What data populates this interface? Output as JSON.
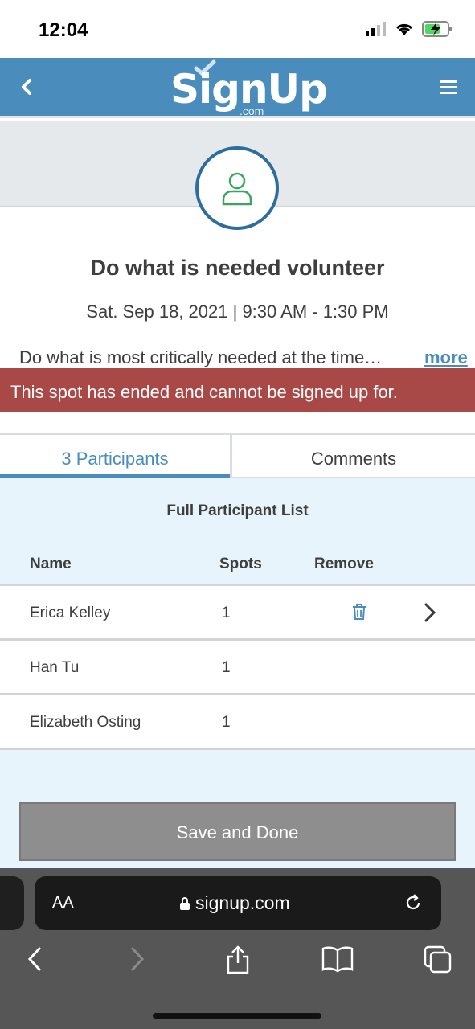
{
  "status_bar": {
    "time": "12:04"
  },
  "header": {
    "logo_text": "SignUp",
    "logo_suffix": ".com"
  },
  "event": {
    "title": "Do what is needed volunteer",
    "datetime": "Sat. Sep 18, 2021 | 9:30 AM - 1:30 PM",
    "description": "Do what is most critically needed at the time…",
    "more_label": "more"
  },
  "alert": {
    "text": "This spot has ended and cannot be signed up for."
  },
  "tabs": [
    {
      "label": "3 Participants",
      "active": true
    },
    {
      "label": "Comments",
      "active": false
    }
  ],
  "participants": {
    "title": "Full Participant List",
    "columns": {
      "name": "Name",
      "spots": "Spots",
      "remove": "Remove"
    },
    "rows": [
      {
        "name": "Erica Kelley",
        "spots": "1",
        "removable": true
      },
      {
        "name": "Han Tu",
        "spots": "1",
        "removable": false
      },
      {
        "name": "Elizabeth Osting",
        "spots": "1",
        "removable": false
      }
    ]
  },
  "save_button": {
    "label": "Save and Done"
  },
  "browser": {
    "text_size_label": "AA",
    "url": "signup.com"
  },
  "colors": {
    "brand_blue": "#4a8dbd",
    "alert_red": "#a94947",
    "avatar_green": "#3aa55d",
    "panel_bg": "#e8f4fb"
  }
}
